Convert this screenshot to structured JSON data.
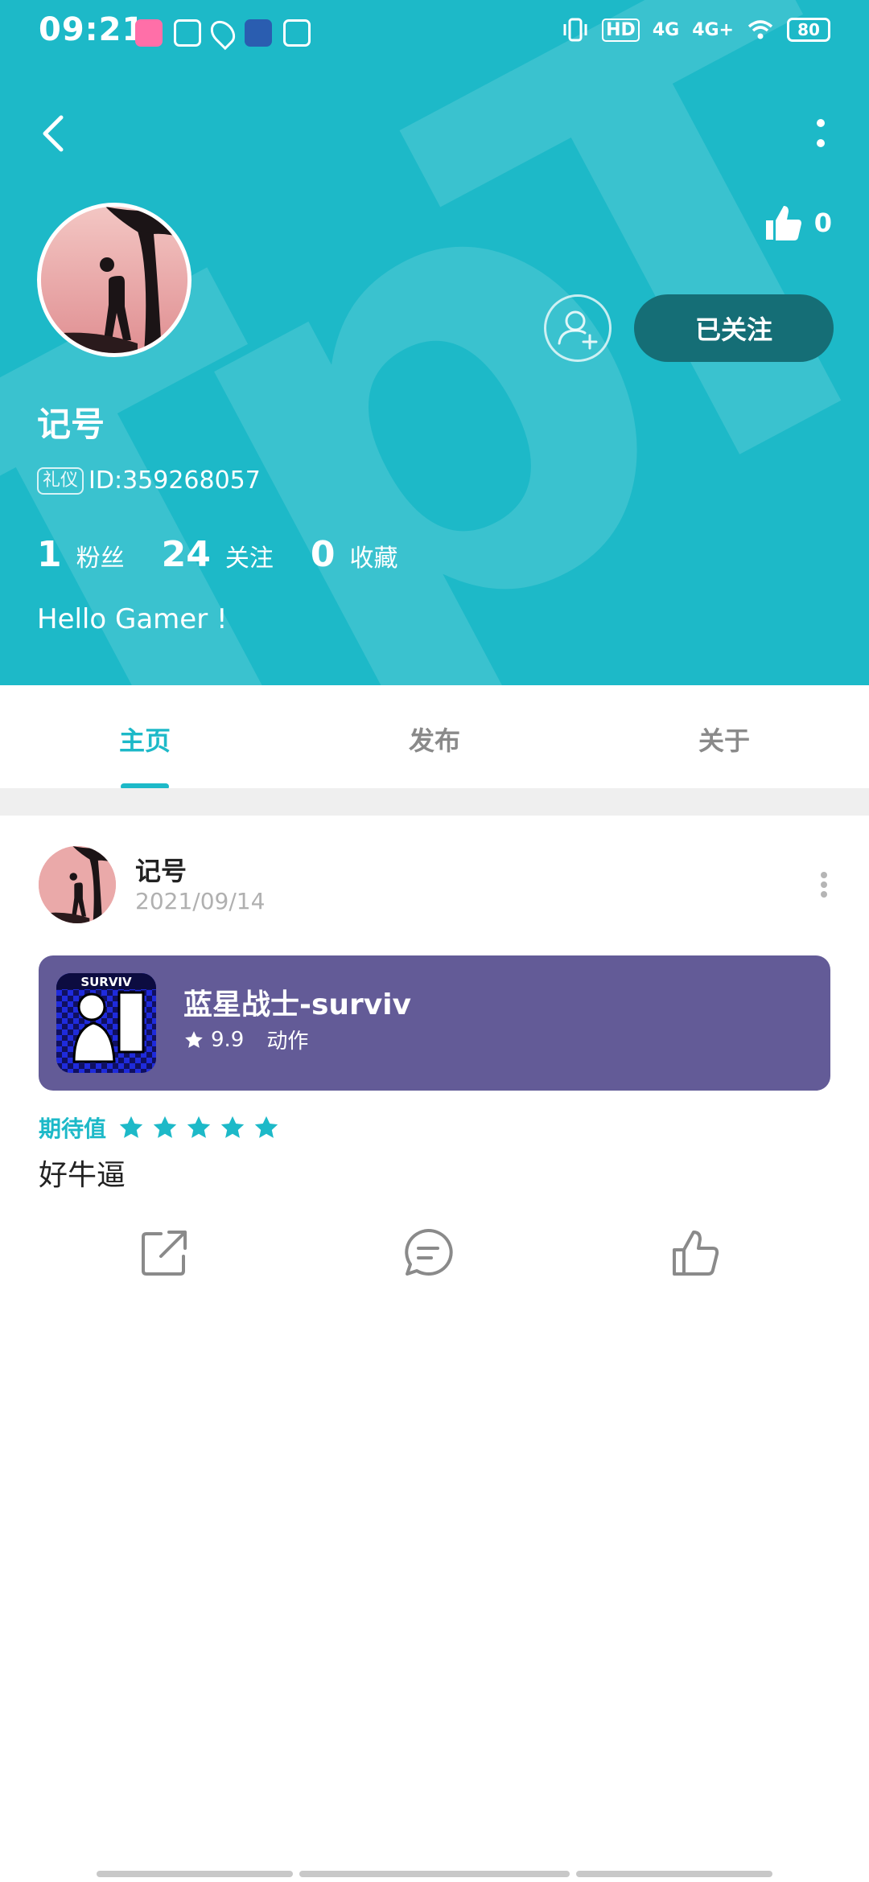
{
  "status_bar": {
    "time": "09:21",
    "network": [
      "4G",
      "4G+"
    ],
    "hd_label": "HD",
    "battery": "80"
  },
  "profile": {
    "watermark": "TapTap",
    "like_count": "0",
    "follow_label": "已关注",
    "username": "记号",
    "id_tag": "礼仪",
    "id_text": "ID:359268057",
    "stats": [
      {
        "num": "1",
        "label": "粉丝"
      },
      {
        "num": "24",
        "label": "关注"
      },
      {
        "num": "0",
        "label": "收藏"
      }
    ],
    "bio": "Hello Gamer !"
  },
  "tabs": [
    {
      "label": "主页",
      "active": true
    },
    {
      "label": "发布",
      "active": false
    },
    {
      "label": "关于",
      "active": false
    }
  ],
  "post": {
    "author": "记号",
    "date": "2021/09/14",
    "game": {
      "title": "蓝星战士-surviv",
      "rating": "9.9",
      "genre": "动作",
      "icon_text": "SURVIV"
    },
    "expect_label": "期待值",
    "expect_stars": 5,
    "text": "好牛逼"
  },
  "colors": {
    "brand": "#1db9c8",
    "follow_button": "#156e76",
    "game_card": "#635b97"
  }
}
